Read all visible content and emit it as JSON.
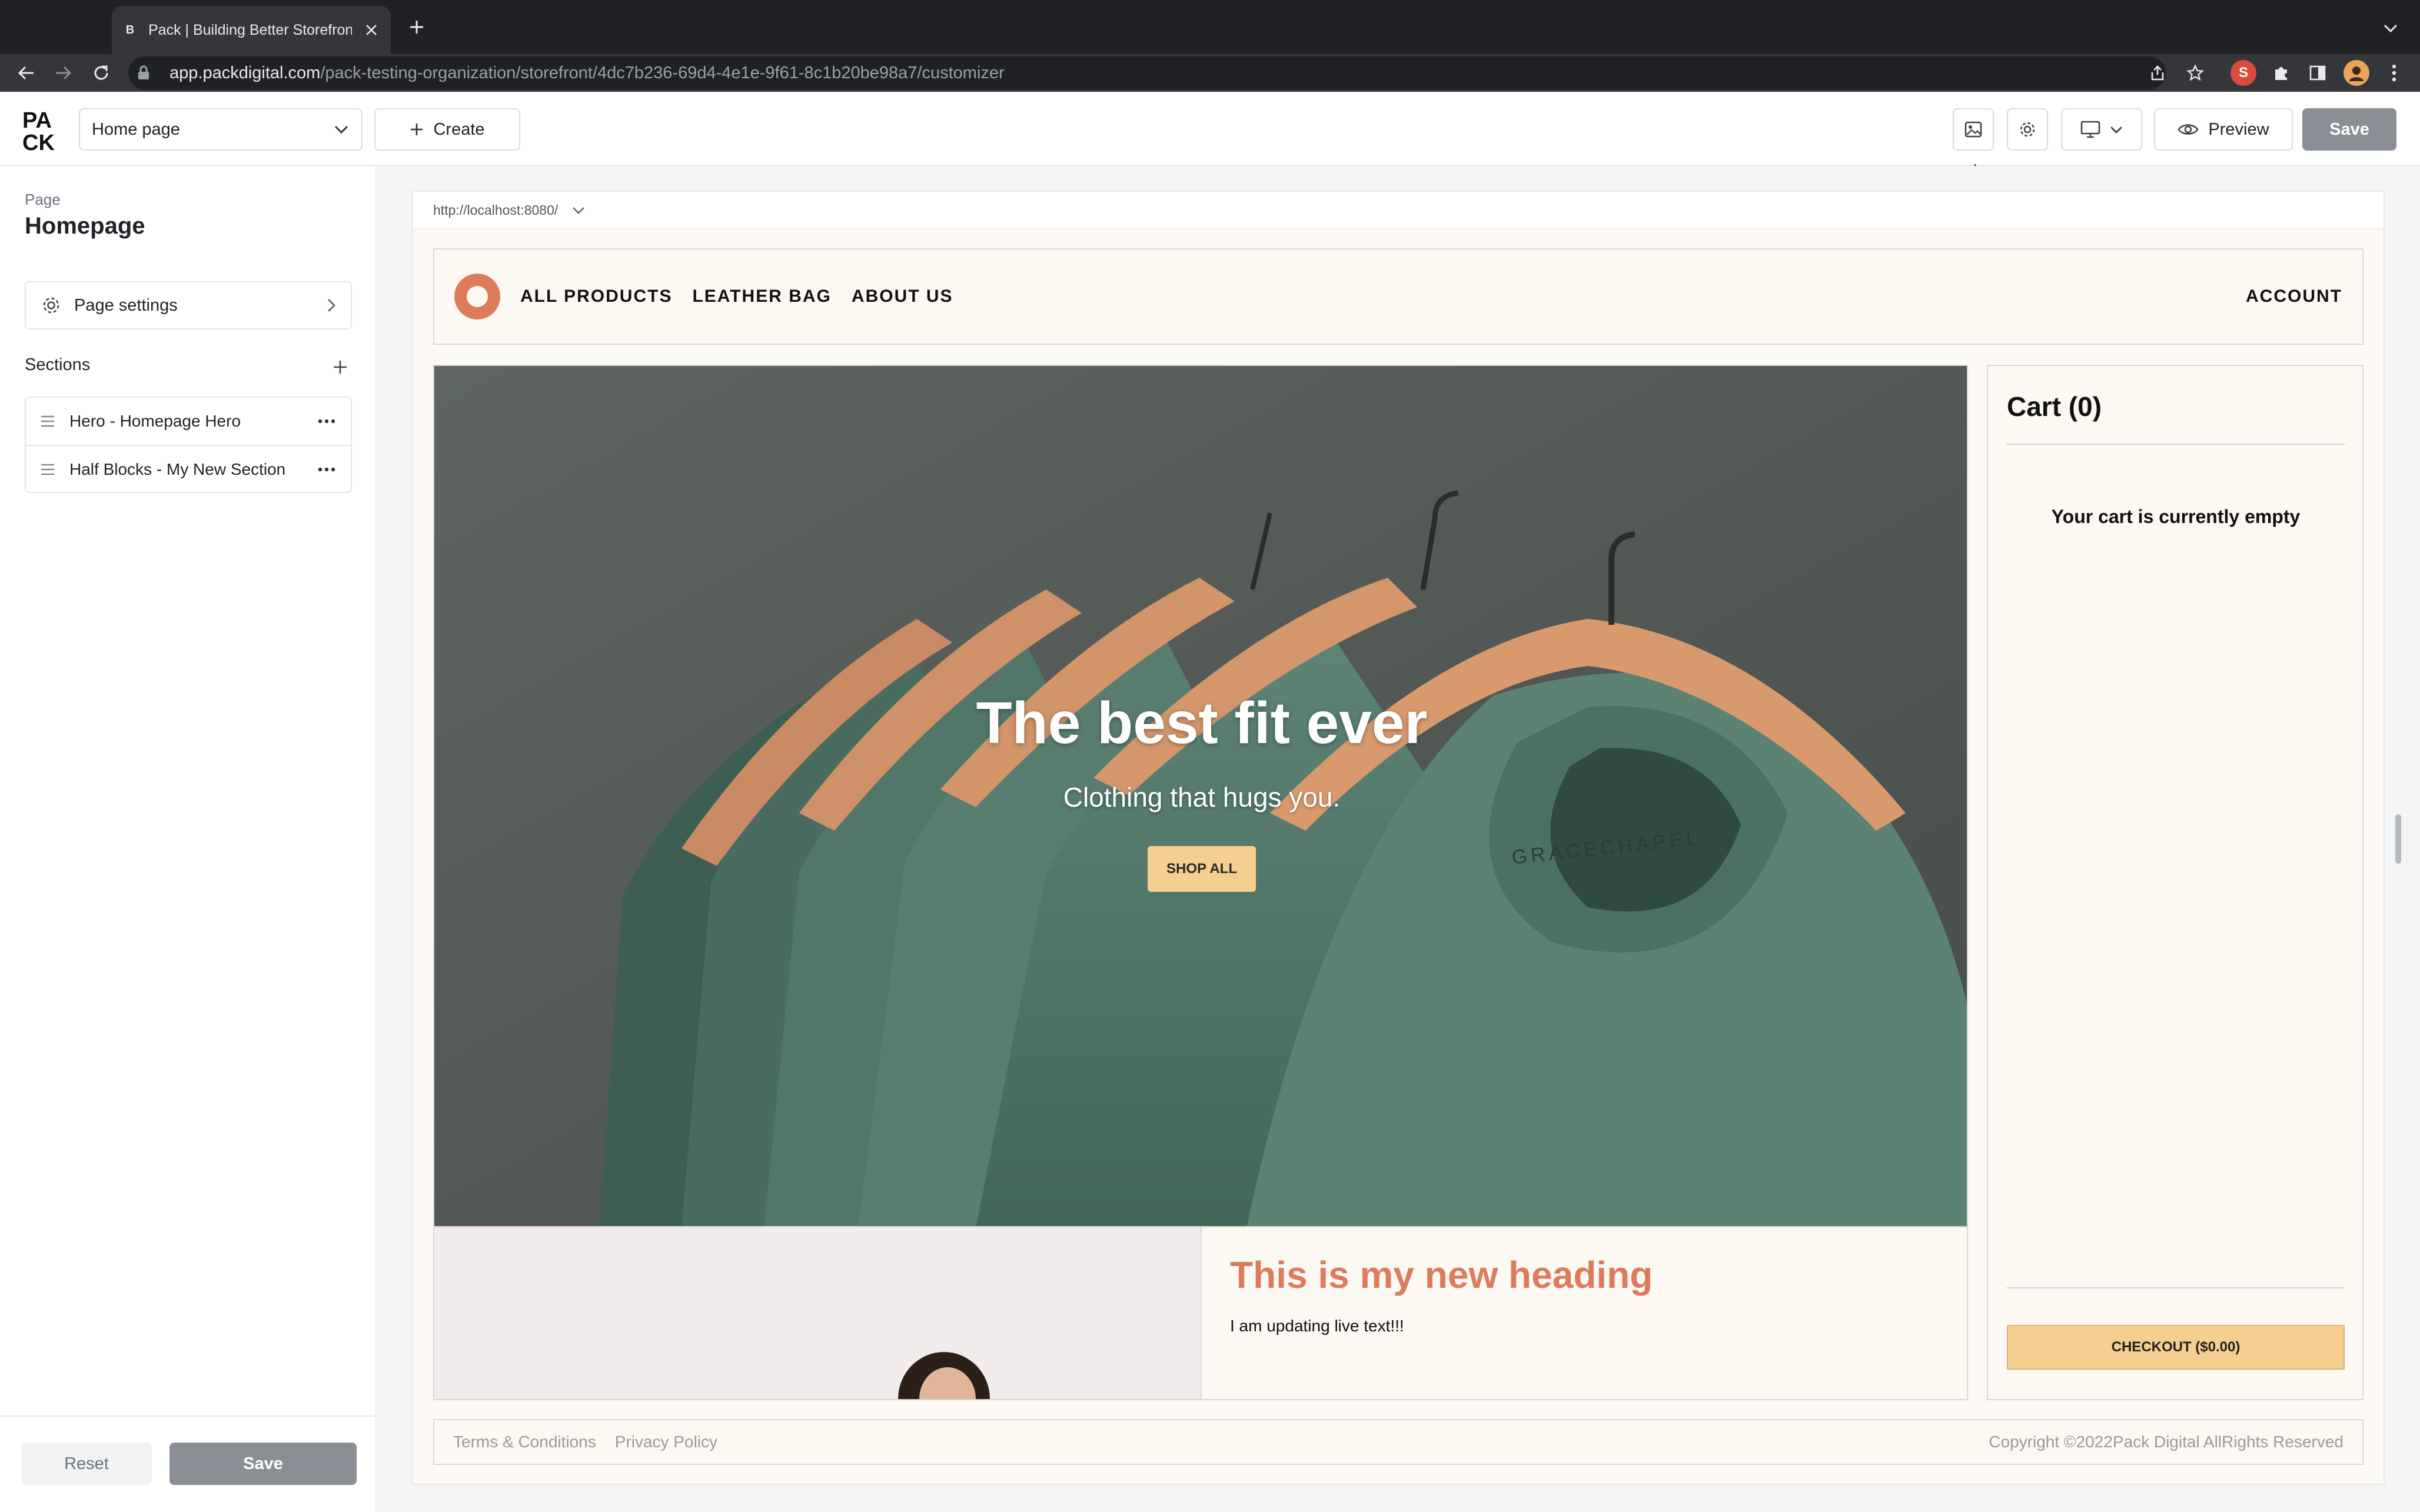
{
  "browser": {
    "tab_title": "Pack | Building Better Storefronts",
    "url_host": "app.packdigital.com",
    "url_path": "/pack-testing-organization/storefront/4dc7b236-69d4-4e1e-9f61-8c1b20be98a7/customizer"
  },
  "header": {
    "logo": "PACK",
    "page_select": "Home page",
    "create_label": "Create",
    "preview_label": "Preview",
    "save_label": "Save"
  },
  "sidebar": {
    "page_label": "Page",
    "page_title": "Homepage",
    "page_settings_label": "Page settings",
    "sections_label": "Sections",
    "sections": [
      {
        "label": "Hero - Homepage Hero"
      },
      {
        "label": "Half Blocks - My New Section"
      }
    ],
    "reset_label": "Reset",
    "save_label": "Save"
  },
  "preview": {
    "url": "http://localhost:8080/",
    "nav": {
      "links": [
        "ALL PRODUCTS",
        "LEATHER BAG",
        "ABOUT US"
      ],
      "account": "ACCOUNT"
    },
    "hero": {
      "heading": "The best fit ever",
      "subheading": "Clothing that hugs you.",
      "button": "SHOP ALL",
      "shirt_brand": "GRACECHAPEL"
    },
    "half_block": {
      "heading": "This is my new heading",
      "body": "I am updating live text!!!"
    },
    "cart": {
      "title": "Cart (0)",
      "empty_message": "Your cart is currently empty",
      "checkout": "CHECKOUT ($0.00)"
    },
    "footer": {
      "links": [
        "Terms & Conditions",
        "Privacy Policy"
      ],
      "copyright": "Copyright ©2022Pack Digital AllRights Reserved"
    }
  },
  "colors": {
    "accent": "#dc7c5d",
    "hero_bg": "#5b7d71",
    "button_gold": "#f5cf90",
    "save_disabled": "#8a8f96"
  },
  "icons": [
    "back-icon",
    "forward-icon",
    "reload-icon",
    "lock-icon",
    "share-icon",
    "star-icon",
    "extension-icon",
    "puzzle-icon",
    "sidepanel-icon",
    "profile-avatar",
    "more-icon",
    "image-icon",
    "gear-icon",
    "desktop-icon",
    "eye-icon",
    "plus-icon",
    "chevron-down-icon",
    "chevron-right-icon",
    "drag-handle-icon",
    "ellipsis-icon"
  ]
}
